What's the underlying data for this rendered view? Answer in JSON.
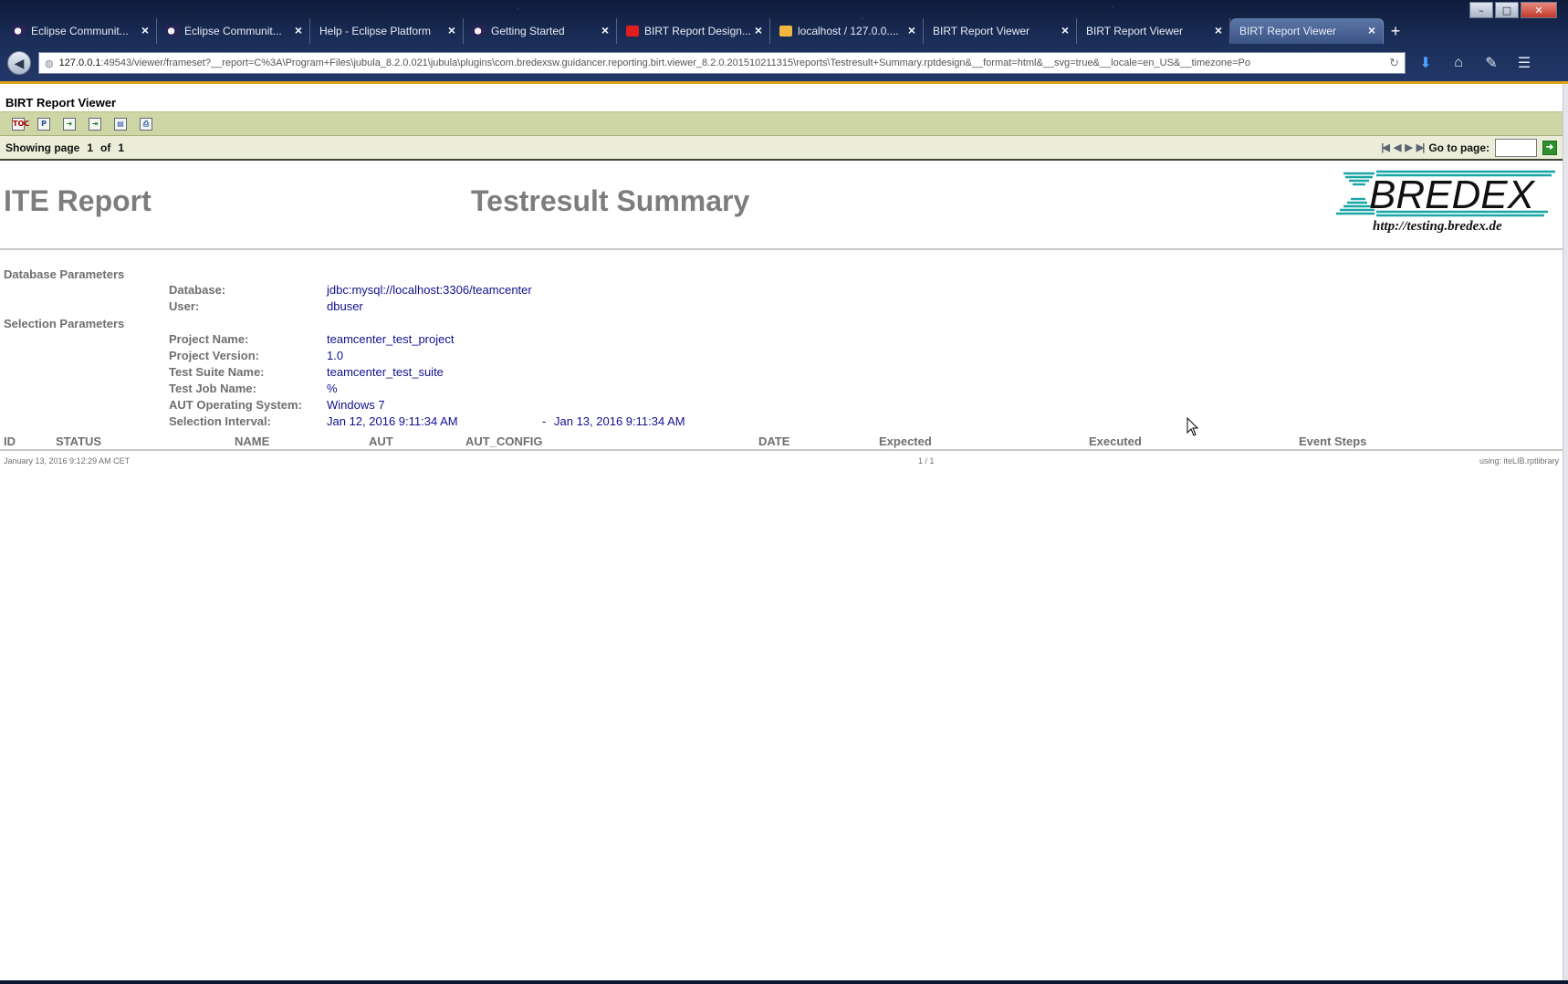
{
  "browser": {
    "tabs": [
      {
        "label": "Eclipse Communit...",
        "favicon": "eclipse-icon",
        "active": false
      },
      {
        "label": "Eclipse Communit...",
        "favicon": "eclipse-icon",
        "active": false
      },
      {
        "label": "Help - Eclipse Platform",
        "favicon": "",
        "active": false
      },
      {
        "label": "Getting Started",
        "favicon": "eclipse-icon",
        "active": false
      },
      {
        "label": "BIRT Report Design...",
        "favicon": "youtube-icon",
        "active": false
      },
      {
        "label": "localhost / 127.0.0....",
        "favicon": "phpmyadmin-icon",
        "active": false
      },
      {
        "label": "BIRT Report Viewer",
        "favicon": "",
        "active": false
      },
      {
        "label": "BIRT Report Viewer",
        "favicon": "",
        "active": false
      },
      {
        "label": "BIRT Report Viewer",
        "favicon": "",
        "active": true
      }
    ],
    "new_tab": "+",
    "url_host": "127.0.0.1",
    "url_rest": ":49543/viewer/frameset?__report=C%3A\\Program+Files\\jubula_8.2.0.021\\jubula\\plugins\\com.bredexsw.guidancer.reporting.birt.viewer_8.2.0.201510211315\\reports\\Testresult+Summary.rptdesign&__format=html&__svg=true&__locale=en_US&__timezone=Po",
    "accent_color": "#e0a21a"
  },
  "viewer": {
    "title": "BIRT Report Viewer",
    "toolbar_icons": [
      "toc-icon",
      "parameter-icon",
      "export-data-icon",
      "export-report-icon",
      "print-icon",
      "print-server-icon"
    ],
    "showing": "Showing page",
    "current_page": "1",
    "of": "of",
    "total_pages": "1",
    "goto_label": "Go to page:"
  },
  "report": {
    "left_title": "ITE Report",
    "main_title": "Testresult Summary",
    "logo_text": "BREDEX",
    "logo_url": "http://testing.bredex.de",
    "database_section": "Database Parameters",
    "selection_section": "Selection Parameters",
    "params": {
      "database_label": "Database:",
      "database_value": "jdbc:mysql://localhost:3306/teamcenter",
      "user_label": "User:",
      "user_value": "dbuser",
      "project_name_label": "Project Name:",
      "project_name_value": "teamcenter_test_project",
      "project_version_label": "Project Version:",
      "project_version_value": "1.0",
      "suite_label": "Test Suite Name:",
      "suite_value": "teamcenter_test_suite",
      "job_label": "Test Job Name:",
      "job_value": "%",
      "os_label": "AUT Operating System:",
      "os_value": "Windows 7",
      "interval_label": "Selection Interval:",
      "interval_from": "Jan 12, 2016 9:11:34 AM",
      "interval_sep": "-",
      "interval_to": "Jan 13, 2016 9:11:34 AM"
    },
    "columns": [
      "ID",
      "STATUS",
      "NAME",
      "AUT",
      "AUT_CONFIG",
      "DATE",
      "Expected",
      "Executed",
      "Event Steps"
    ],
    "footer": {
      "timestamp": "January 13, 2016 9:12:29 AM CET",
      "page": "1  /  1",
      "library": "using: iteLIB.rptlibrary"
    }
  }
}
